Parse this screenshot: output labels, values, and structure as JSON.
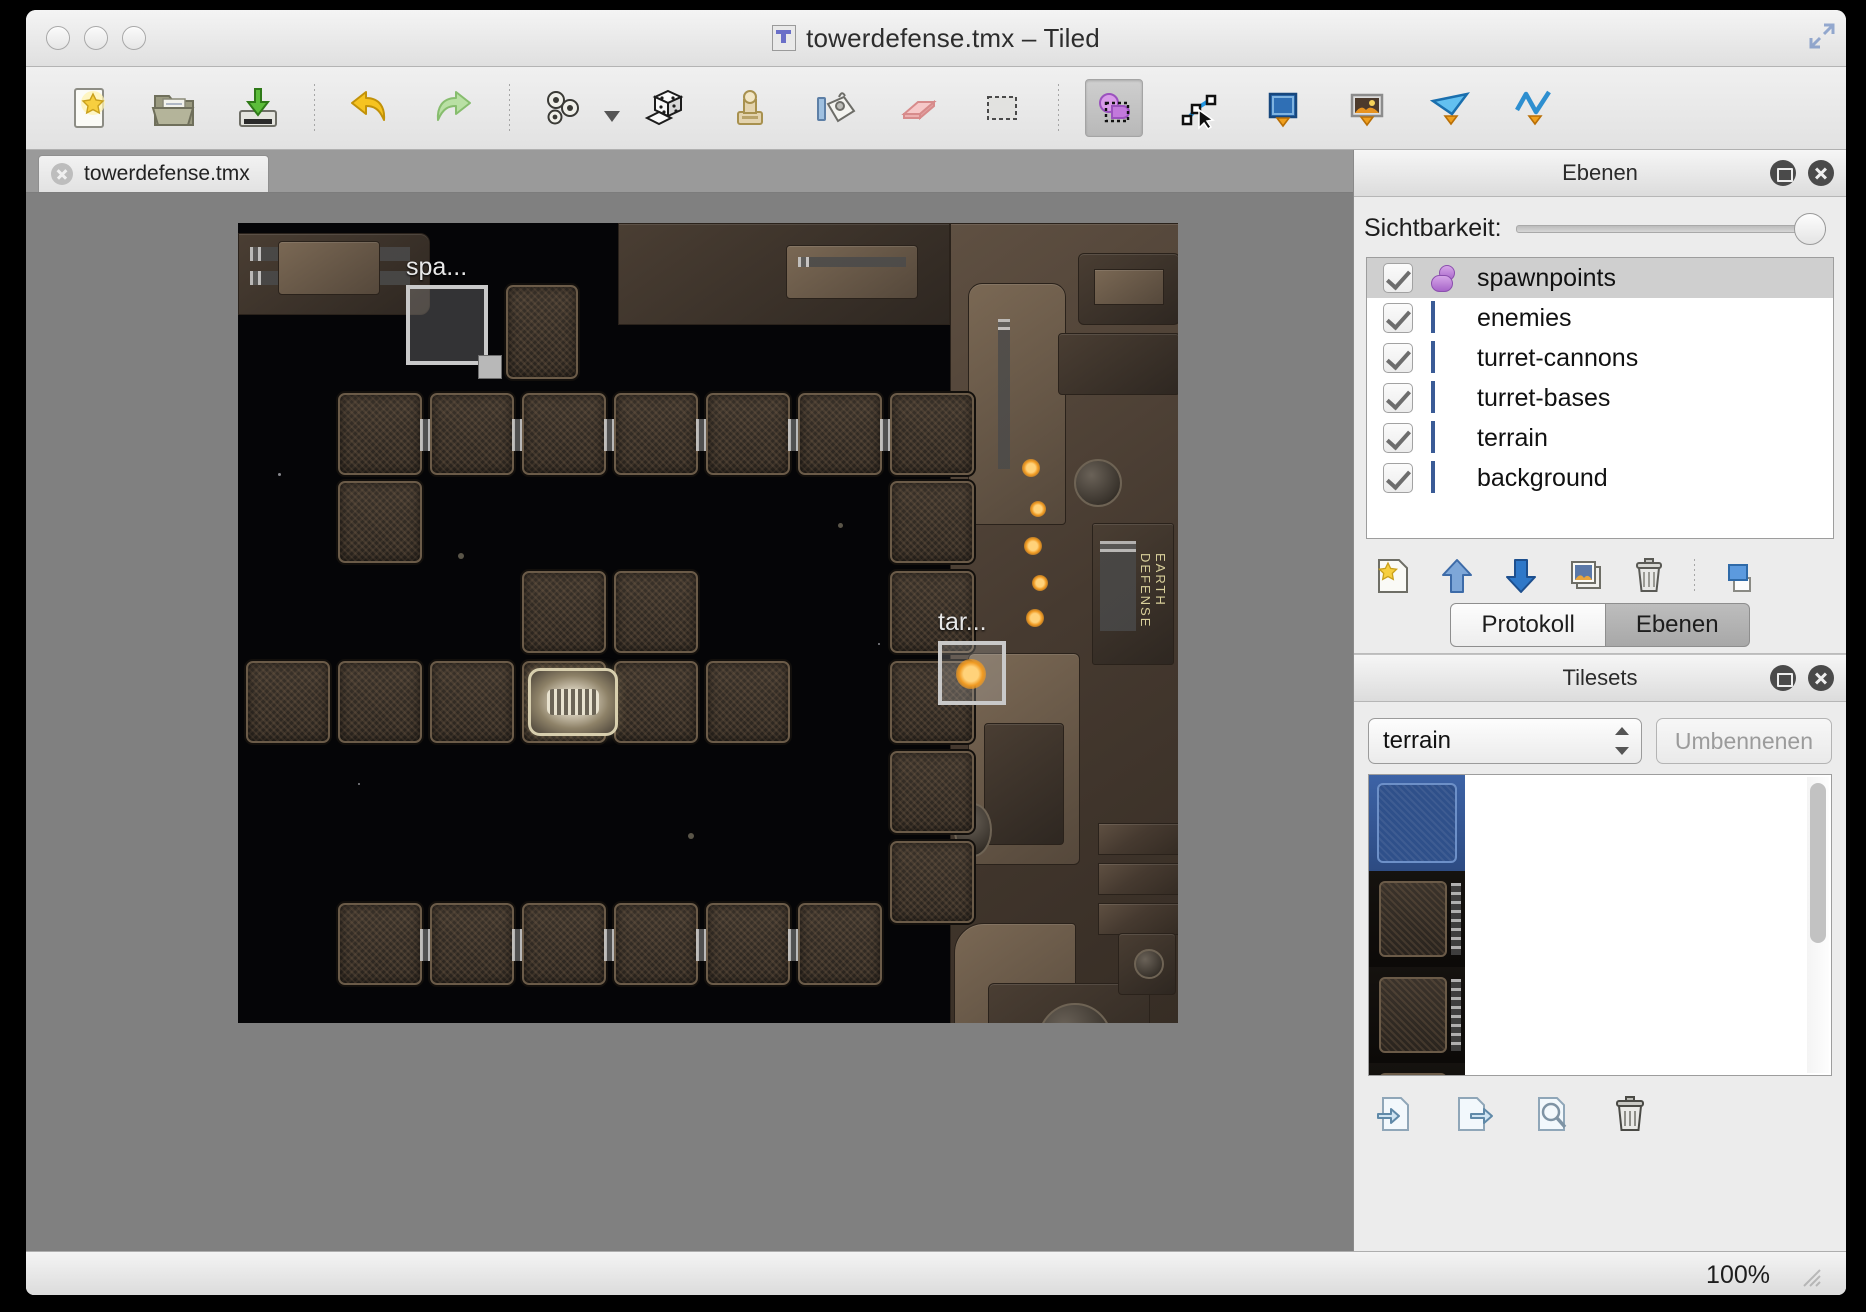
{
  "window": {
    "title": "towerdefense.tmx – Tiled",
    "app_icon": "tiled-file-icon"
  },
  "toolbar": {
    "items": [
      {
        "name": "new-map",
        "icon": "new-document-star-icon",
        "label": "Neu",
        "active": false
      },
      {
        "name": "open-map",
        "icon": "open-folder-icon",
        "label": "Öffnen",
        "active": false
      },
      {
        "name": "save-map",
        "icon": "save-disk-icon",
        "label": "Speichern",
        "active": false
      },
      {
        "name": "undo",
        "icon": "undo-arrow-icon",
        "label": "Rückgängig",
        "active": false
      },
      {
        "name": "redo",
        "icon": "redo-arrow-icon",
        "label": "Wiederherstellen",
        "active": false
      },
      {
        "name": "stamp-brush",
        "icon": "gears-stamp-icon",
        "label": "Stempel",
        "active": false
      },
      {
        "name": "random-mode",
        "icon": "dice-icon",
        "label": "Zufall",
        "active": false
      },
      {
        "name": "terrain-brush",
        "icon": "terrain-stamp-icon",
        "label": "Terrain",
        "active": false
      },
      {
        "name": "fill-tool",
        "icon": "paint-bucket-icon",
        "label": "Füllen",
        "active": false
      },
      {
        "name": "eraser-tool",
        "icon": "eraser-icon",
        "label": "Radierer",
        "active": false
      },
      {
        "name": "rect-select-tool",
        "icon": "rectangle-select-icon",
        "label": "Rechteckauswahl",
        "active": false
      },
      {
        "name": "object-select-tool",
        "icon": "object-select-icon",
        "label": "Objekte auswählen",
        "active": true
      },
      {
        "name": "edit-polygons-tool",
        "icon": "edit-polygons-icon",
        "label": "Polygone bearbeiten",
        "active": false
      },
      {
        "name": "insert-rectangle-tool",
        "icon": "insert-rectangle-icon",
        "label": "Rechteck einfügen",
        "active": false
      },
      {
        "name": "insert-tile-tool",
        "icon": "insert-tile-icon",
        "label": "Kachel einfügen",
        "active": false
      },
      {
        "name": "insert-polygon-tool",
        "icon": "insert-polygon-icon",
        "label": "Polygon einfügen",
        "active": false
      },
      {
        "name": "insert-polyline-tool",
        "icon": "insert-polyline-icon",
        "label": "Linienzug einfügen",
        "active": false
      }
    ]
  },
  "document_tabs": [
    {
      "name": "tab-towerdefense",
      "label": "towerdefense.tmx",
      "active": true,
      "closable": true
    }
  ],
  "map_objects": [
    {
      "name": "object-spawn",
      "label": "spa...",
      "type": "rectangle",
      "selected": true
    },
    {
      "name": "object-target",
      "label": "tar...",
      "type": "rectangle",
      "selected": true
    }
  ],
  "layers_panel": {
    "title": "Ebenen",
    "visibility_label": "Sichtbarkeit:",
    "visibility_value": 100,
    "layers": [
      {
        "name": "spawnpoints",
        "icon": "object-layer-icon",
        "visible": true,
        "selected": true
      },
      {
        "name": "enemies",
        "icon": "tile-layer-icon",
        "visible": true,
        "selected": false
      },
      {
        "name": "turret-cannons",
        "icon": "tile-layer-icon",
        "visible": true,
        "selected": false
      },
      {
        "name": "turret-bases",
        "icon": "tile-layer-icon",
        "visible": true,
        "selected": false
      },
      {
        "name": "terrain",
        "icon": "tile-layer-icon",
        "visible": true,
        "selected": false
      },
      {
        "name": "background",
        "icon": "tile-layer-icon",
        "visible": true,
        "selected": false
      }
    ],
    "actions": [
      {
        "name": "new-layer-button",
        "icon": "new-layer-icon"
      },
      {
        "name": "move-layer-up-button",
        "icon": "arrow-up-icon"
      },
      {
        "name": "move-layer-down-button",
        "icon": "arrow-down-icon"
      },
      {
        "name": "duplicate-layer-button",
        "icon": "duplicate-layer-icon"
      },
      {
        "name": "delete-layer-button",
        "icon": "trash-icon"
      },
      {
        "name": "layer-properties-button",
        "icon": "layer-properties-icon"
      }
    ],
    "tabs": [
      {
        "name": "tab-protokoll",
        "label": "Protokoll",
        "selected": false
      },
      {
        "name": "tab-ebenen",
        "label": "Ebenen",
        "selected": true
      }
    ]
  },
  "tilesets_panel": {
    "title": "Tilesets",
    "selected_tileset": "terrain",
    "tileset_options": [
      "terrain"
    ],
    "rename_button": "Umbennenen",
    "actions": [
      {
        "name": "add-tileset-button",
        "icon": "import-tileset-icon"
      },
      {
        "name": "export-tileset-button",
        "icon": "export-tileset-icon"
      },
      {
        "name": "tileset-properties-button",
        "icon": "tileset-properties-icon"
      },
      {
        "name": "remove-tileset-button",
        "icon": "trash-icon"
      }
    ],
    "tiles": [
      {
        "name": "tile-0",
        "selected": true
      },
      {
        "name": "tile-1",
        "selected": false
      },
      {
        "name": "tile-2",
        "selected": false
      },
      {
        "name": "tile-3",
        "selected": false
      }
    ]
  },
  "statusbar": {
    "zoom": "100%"
  }
}
